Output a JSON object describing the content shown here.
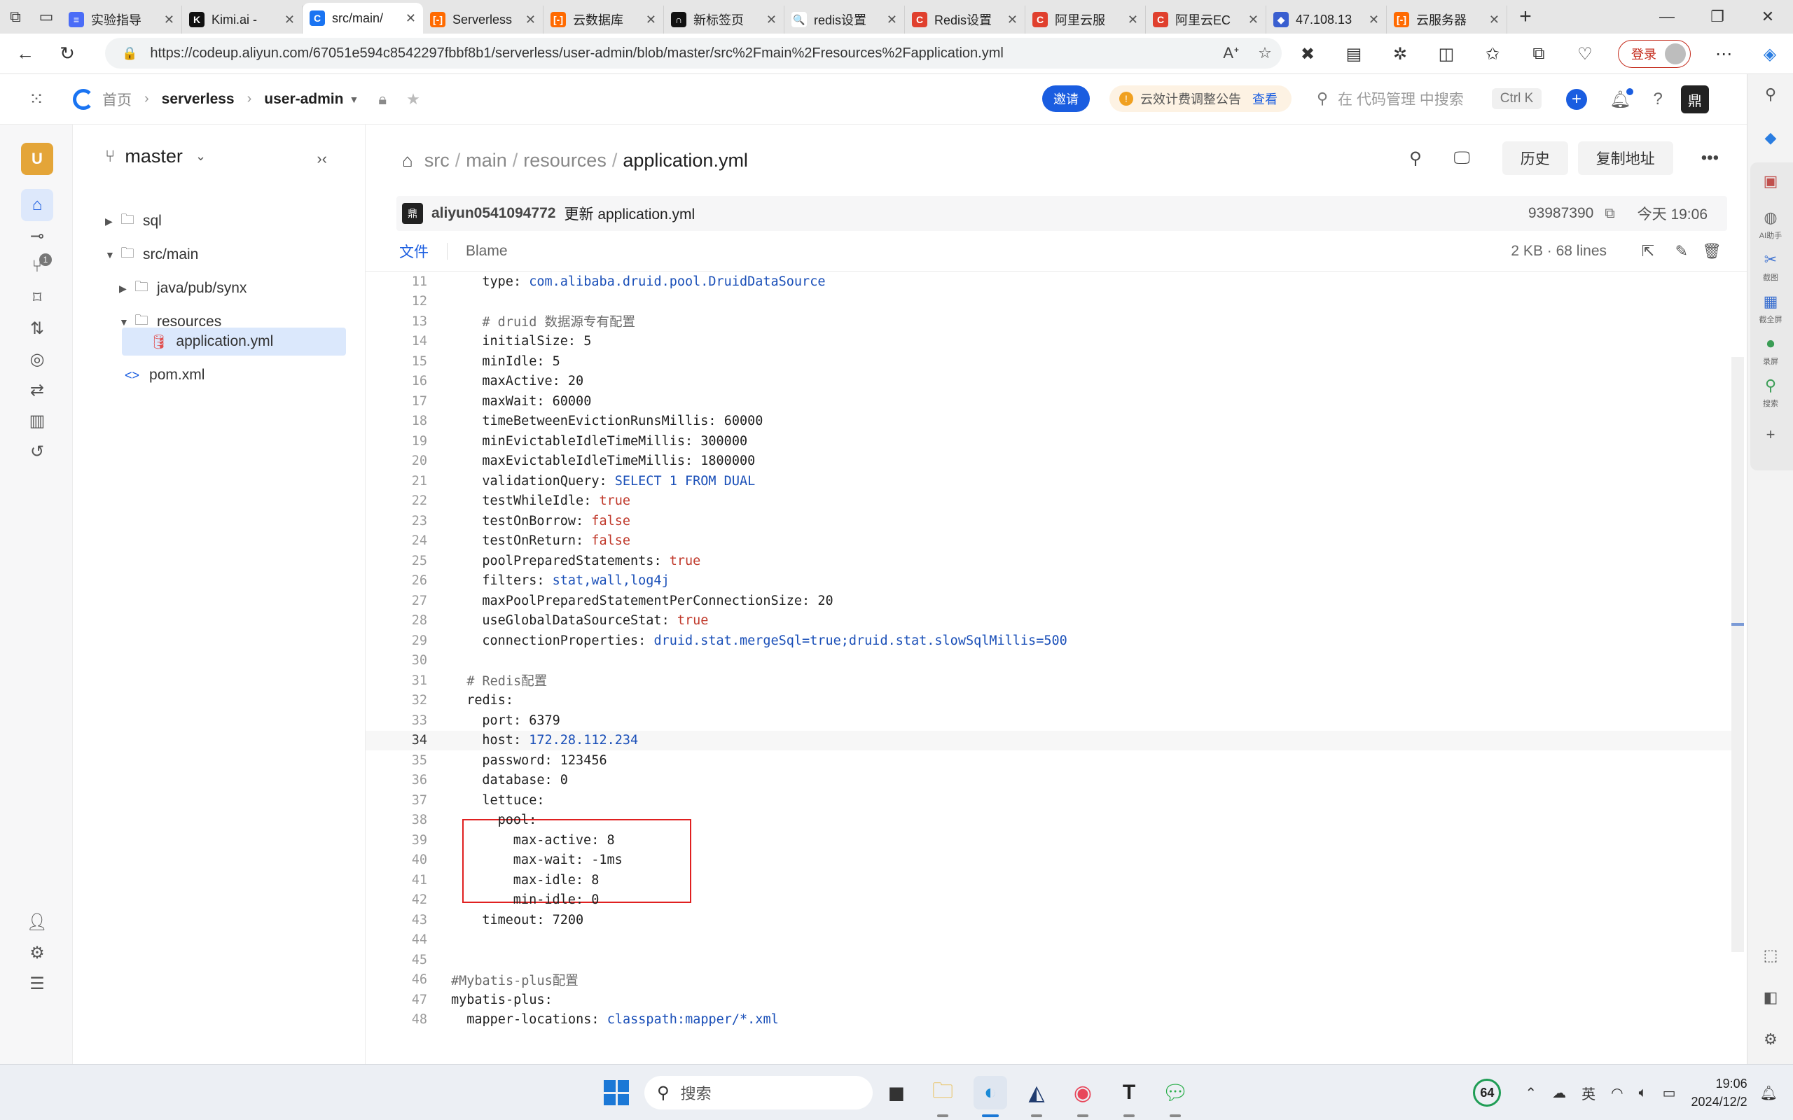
{
  "browser": {
    "tabs": [
      {
        "label": "实验指导",
        "fav_color": "#4a6cf7",
        "fav_glyph": "≡"
      },
      {
        "label": "Kimi.ai - ",
        "fav_color": "#111111",
        "fav_glyph": "K"
      },
      {
        "label": "src/main/",
        "fav_color": "#1a74f2",
        "fav_glyph": "C",
        "active": true
      },
      {
        "label": "Serverless",
        "fav_color": "#ff6a00",
        "fav_glyph": "[-]"
      },
      {
        "label": "云数据库",
        "fav_color": "#ff6a00",
        "fav_glyph": "[-]"
      },
      {
        "label": "新标签页",
        "fav_color": "#111111",
        "fav_glyph": "∩"
      },
      {
        "label": "redis设置",
        "fav_color": "#ffffff",
        "fav_glyph": "🔍"
      },
      {
        "label": "Redis设置",
        "fav_color": "#e0402e",
        "fav_glyph": "C"
      },
      {
        "label": "阿里云服",
        "fav_color": "#e0402e",
        "fav_glyph": "C"
      },
      {
        "label": "阿里云EC",
        "fav_color": "#e0402e",
        "fav_glyph": "C"
      },
      {
        "label": "47.108.13",
        "fav_color": "#3a5fd0",
        "fav_glyph": "◆"
      },
      {
        "label": "云服务器",
        "fav_color": "#ff6a00",
        "fav_glyph": "[-]"
      }
    ],
    "url": "https://codeup.aliyun.com/67051e594c8542297fbbf8b1/serverless/user-admin/blob/master/src%2Fmain%2Fresources%2Fapplication.yml",
    "login_label": "登录"
  },
  "header": {
    "home": "首页",
    "group": "serverless",
    "repo": "user-admin",
    "invite": "邀请",
    "notice": "云效计费调整公告",
    "notice_link": "查看",
    "search_placeholder": "在 代码管理 中搜索",
    "shortcut": "Ctrl K"
  },
  "rail": {
    "avatar": "U",
    "badge": "1"
  },
  "tree": {
    "branch": "master",
    "items": [
      {
        "label": "sql",
        "type": "folder",
        "caret": "▶"
      },
      {
        "label": "src/main",
        "type": "folder",
        "caret": "▼"
      },
      {
        "label": "java/pub/synx",
        "type": "folder",
        "caret": "▶"
      },
      {
        "label": "resources",
        "type": "folder",
        "caret": "▼"
      },
      {
        "label": "application.yml",
        "type": "file"
      },
      {
        "label": "pom.xml",
        "type": "file"
      }
    ]
  },
  "file": {
    "path": [
      "src",
      "main",
      "resources"
    ],
    "name": "application.yml",
    "history": "历史",
    "copy_address": "复制地址",
    "commit_author": "aliyun0541094772",
    "commit_message": "更新 application.yml",
    "commit_hash": "93987390",
    "commit_time": "今天 19:06",
    "tab_file": "文件",
    "tab_blame": "Blame",
    "meta": "2 KB · 68 lines",
    "current_line": 34
  },
  "code_lines": [
    {
      "n": 11,
      "indent": 4,
      "key": "type",
      "val": "com.alibaba.druid.pool.DruidDataSource",
      "vt": "str"
    },
    {
      "n": 12,
      "indent": 0,
      "key": "",
      "val": "",
      "vt": ""
    },
    {
      "n": 13,
      "indent": 4,
      "key": "",
      "val": "# druid 数据源专有配置",
      "vt": "cm"
    },
    {
      "n": 14,
      "indent": 4,
      "key": "initialSize",
      "val": "5",
      "vt": "num"
    },
    {
      "n": 15,
      "indent": 4,
      "key": "minIdle",
      "val": "5",
      "vt": "num"
    },
    {
      "n": 16,
      "indent": 4,
      "key": "maxActive",
      "val": "20",
      "vt": "num"
    },
    {
      "n": 17,
      "indent": 4,
      "key": "maxWait",
      "val": "60000",
      "vt": "num"
    },
    {
      "n": 18,
      "indent": 4,
      "key": "timeBetweenEvictionRunsMillis",
      "val": "60000",
      "vt": "num"
    },
    {
      "n": 19,
      "indent": 4,
      "key": "minEvictableIdleTimeMillis",
      "val": "300000",
      "vt": "num"
    },
    {
      "n": 20,
      "indent": 4,
      "key": "maxEvictableIdleTimeMillis",
      "val": "1800000",
      "vt": "num"
    },
    {
      "n": 21,
      "indent": 4,
      "key": "validationQuery",
      "val": "SELECT 1 FROM DUAL",
      "vt": "str"
    },
    {
      "n": 22,
      "indent": 4,
      "key": "testWhileIdle",
      "val": "true",
      "vt": "bool"
    },
    {
      "n": 23,
      "indent": 4,
      "key": "testOnBorrow",
      "val": "false",
      "vt": "bool"
    },
    {
      "n": 24,
      "indent": 4,
      "key": "testOnReturn",
      "val": "false",
      "vt": "bool"
    },
    {
      "n": 25,
      "indent": 4,
      "key": "poolPreparedStatements",
      "val": "true",
      "vt": "bool"
    },
    {
      "n": 26,
      "indent": 4,
      "key": "filters",
      "val": "stat,wall,log4j",
      "vt": "str"
    },
    {
      "n": 27,
      "indent": 4,
      "key": "maxPoolPreparedStatementPerConnectionSize",
      "val": "20",
      "vt": "num"
    },
    {
      "n": 28,
      "indent": 4,
      "key": "useGlobalDataSourceStat",
      "val": "true",
      "vt": "bool"
    },
    {
      "n": 29,
      "indent": 4,
      "key": "connectionProperties",
      "val": "druid.stat.mergeSql=true;druid.stat.slowSqlMillis=500",
      "vt": "str"
    },
    {
      "n": 30,
      "indent": 0,
      "key": "",
      "val": "",
      "vt": ""
    },
    {
      "n": 31,
      "indent": 2,
      "key": "",
      "val": "# Redis配置",
      "vt": "cm"
    },
    {
      "n": 32,
      "indent": 2,
      "key": "redis",
      "val": "",
      "vt": ""
    },
    {
      "n": 33,
      "indent": 4,
      "key": "port",
      "val": "6379",
      "vt": "num"
    },
    {
      "n": 34,
      "indent": 4,
      "key": "host",
      "val": "172.28.112.234",
      "vt": "str"
    },
    {
      "n": 35,
      "indent": 4,
      "key": "password",
      "val": "123456",
      "vt": "num"
    },
    {
      "n": 36,
      "indent": 4,
      "key": "database",
      "val": "0",
      "vt": "num"
    },
    {
      "n": 37,
      "indent": 4,
      "key": "lettuce",
      "val": "",
      "vt": ""
    },
    {
      "n": 38,
      "indent": 6,
      "key": "pool",
      "val": "",
      "vt": ""
    },
    {
      "n": 39,
      "indent": 8,
      "key": "max-active",
      "val": "8",
      "vt": "num"
    },
    {
      "n": 40,
      "indent": 8,
      "key": "max-wait",
      "val": "-1ms",
      "vt": "num"
    },
    {
      "n": 41,
      "indent": 8,
      "key": "max-idle",
      "val": "8",
      "vt": "num"
    },
    {
      "n": 42,
      "indent": 8,
      "key": "min-idle",
      "val": "0",
      "vt": "num"
    },
    {
      "n": 43,
      "indent": 4,
      "key": "timeout",
      "val": "7200",
      "vt": "num"
    },
    {
      "n": 44,
      "indent": 0,
      "key": "",
      "val": "",
      "vt": ""
    },
    {
      "n": 45,
      "indent": 0,
      "key": "",
      "val": "",
      "vt": ""
    },
    {
      "n": 46,
      "indent": 0,
      "key": "",
      "val": "#Mybatis-plus配置",
      "vt": "cm"
    },
    {
      "n": 47,
      "indent": 0,
      "key": "mybatis-plus",
      "val": "",
      "vt": ""
    },
    {
      "n": 48,
      "indent": 2,
      "key": "mapper-locations",
      "val": "classpath:mapper/*.xml",
      "vt": "str"
    }
  ],
  "sidebar_labels": [
    "AI助手",
    "截图",
    "截全屏",
    "录屏",
    "搜索"
  ],
  "taskbar": {
    "search": "搜索",
    "battery": "64",
    "ime": "英",
    "time": "19:06",
    "date": "2024/12/2"
  },
  "colors": {
    "accent": "#1a5de0",
    "highlight_box": "#e02020"
  }
}
